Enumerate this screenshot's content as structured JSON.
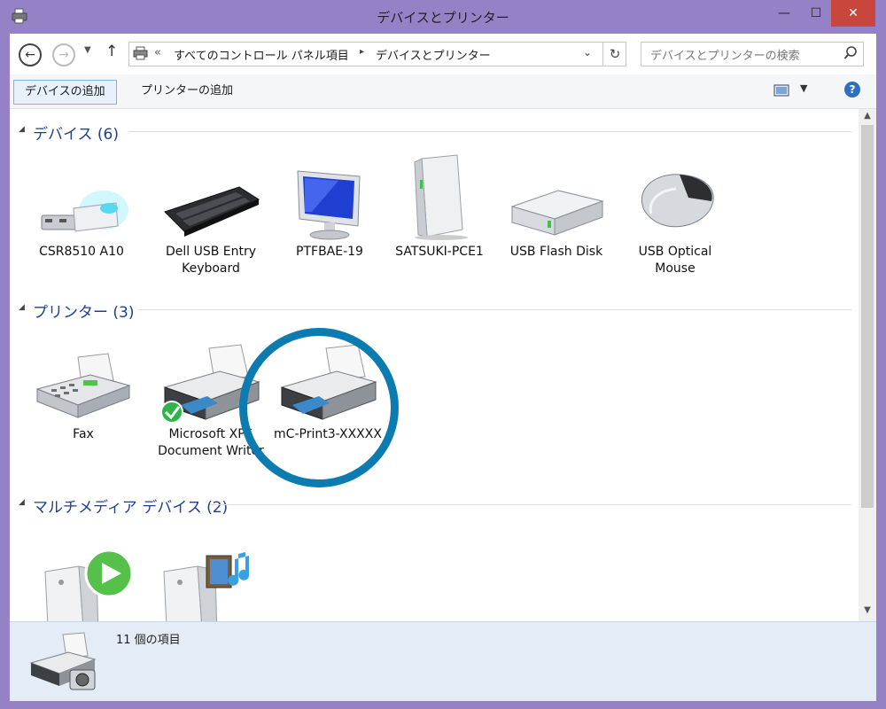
{
  "window": {
    "title": "デバイスとプリンター",
    "minimize": "—",
    "maximize": "☐",
    "close": "✕"
  },
  "nav": {
    "breadcrumb_prefix": "«",
    "crumbs": [
      "すべてのコントロール パネル項目",
      "デバイスとプリンター"
    ],
    "crumb_sep": "▸",
    "search_placeholder": "デバイスとプリンターの検索"
  },
  "toolbar": {
    "add_device": "デバイスの追加",
    "add_printer": "プリンターの追加"
  },
  "groups": {
    "devices": {
      "title": "デバイス (6)",
      "items": [
        {
          "label": "CSR8510 A10",
          "icon": "usb-bluetooth-dongle-icon"
        },
        {
          "label": "Dell USB Entry Keyboard",
          "icon": "keyboard-icon"
        },
        {
          "label": "PTFBAE-19",
          "icon": "monitor-icon"
        },
        {
          "label": "SATSUKI-PCE1",
          "icon": "computer-tower-icon"
        },
        {
          "label": "USB Flash Disk",
          "icon": "external-drive-icon"
        },
        {
          "label": "USB Optical Mouse",
          "icon": "mouse-icon"
        }
      ]
    },
    "printers": {
      "title": "プリンター (3)",
      "items": [
        {
          "label": "Fax",
          "icon": "fax-icon"
        },
        {
          "label": "Microsoft XPS Document Writer",
          "icon": "printer-default-icon"
        },
        {
          "label": "mC-Print3-XXXXX",
          "icon": "printer-icon"
        }
      ]
    },
    "multimedia": {
      "title": "マルチメディア デバイス (2)",
      "items": [
        {
          "label": "",
          "icon": "media-server-play-icon"
        },
        {
          "label": "",
          "icon": "media-server-music-icon"
        }
      ]
    }
  },
  "status": {
    "count_text": "11 個の項目"
  },
  "colors": {
    "titlebar": "#9582c6",
    "close": "#c9463d",
    "group_title": "#1e3f8a",
    "highlight_ring": "#0b7bb0"
  }
}
